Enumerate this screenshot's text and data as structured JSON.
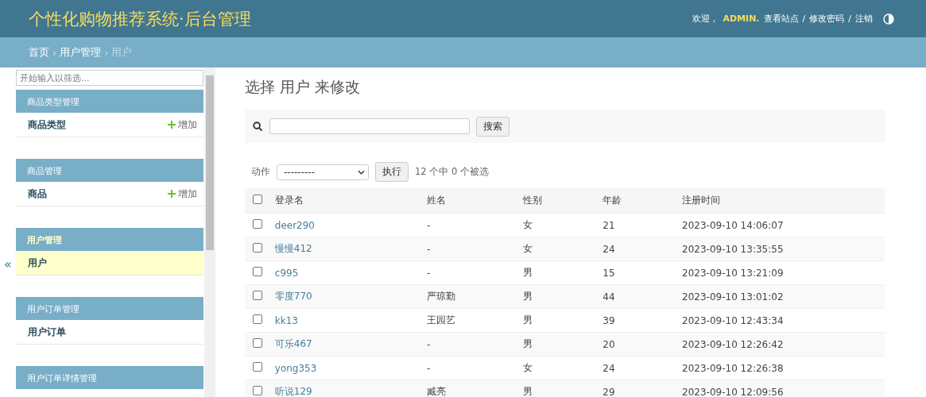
{
  "header": {
    "title": "个性化购物推荐系统·后台管理",
    "welcome": "欢迎，",
    "username": "ADMIN.",
    "links": [
      "查看站点",
      "修改密码",
      "注销"
    ],
    "separator": "/"
  },
  "breadcrumbs": [
    {
      "label": "首页",
      "link": true
    },
    {
      "label": "用户管理",
      "link": true
    },
    {
      "label": "用户",
      "link": false
    }
  ],
  "breadcrumb_separator": "›",
  "sidebar": {
    "filter_placeholder": "开始输入以筛选...",
    "collapse": "«",
    "sections": [
      {
        "caption": "商品类型管理",
        "current": false,
        "items": [
          {
            "label": "商品类型",
            "add": "增加",
            "current": false
          }
        ]
      },
      {
        "caption": "商品管理",
        "current": false,
        "items": [
          {
            "label": "商品",
            "add": "增加",
            "current": false
          }
        ]
      },
      {
        "caption": "用户管理",
        "current": true,
        "items": [
          {
            "label": "用户",
            "current": true
          }
        ]
      },
      {
        "caption": "用户订单管理",
        "current": false,
        "items": [
          {
            "label": "用户订单",
            "current": false
          }
        ]
      },
      {
        "caption": "用户订单详情管理",
        "current": false
      }
    ]
  },
  "page_title": "选择 用户 来修改",
  "search": {
    "button": "搜索"
  },
  "actions": {
    "label": "动作",
    "select": "---------",
    "go": "执行",
    "counter": "12 个中 0 个被选"
  },
  "table": {
    "select_all": false,
    "columns": [
      "登录名",
      "姓名",
      "性别",
      "年龄",
      "注册时间"
    ],
    "rows": [
      {
        "checked": false,
        "cells": [
          "deer290",
          "-",
          "女",
          "21",
          "2023-09-10 14:06:07"
        ]
      },
      {
        "checked": false,
        "cells": [
          "慢慢412",
          "-",
          "女",
          "24",
          "2023-09-10 13:35:55"
        ]
      },
      {
        "checked": false,
        "cells": [
          "c995",
          "-",
          "男",
          "15",
          "2023-09-10 13:21:09"
        ]
      },
      {
        "checked": false,
        "cells": [
          "零度770",
          "严琼勤",
          "男",
          "44",
          "2023-09-10 13:01:02"
        ]
      },
      {
        "checked": false,
        "cells": [
          "kk13",
          "王园艺",
          "男",
          "39",
          "2023-09-10 12:43:34"
        ]
      },
      {
        "checked": false,
        "cells": [
          "可乐467",
          "-",
          "男",
          "20",
          "2023-09-10 12:26:42"
        ]
      },
      {
        "checked": false,
        "cells": [
          "yong353",
          "-",
          "女",
          "24",
          "2023-09-10 12:26:38"
        ]
      },
      {
        "checked": false,
        "cells": [
          "听说129",
          "臧亮",
          "男",
          "29",
          "2023-09-10 12:09:56"
        ]
      }
    ]
  }
}
